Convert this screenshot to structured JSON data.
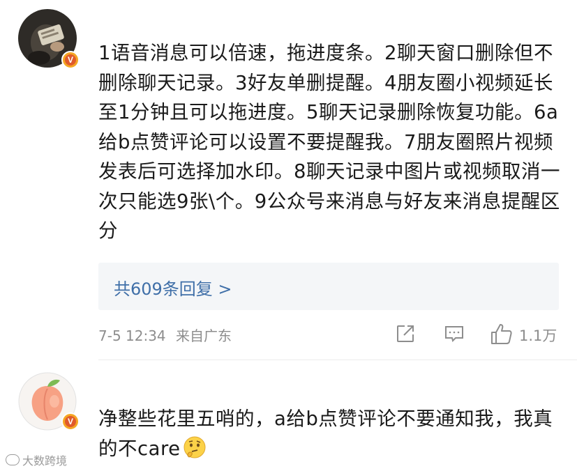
{
  "comments": [
    {
      "avatar": "photo-avatar",
      "badge": "V",
      "text": "1语音消息可以倍速，拖进度条。2聊天窗口删除但不删除聊天记录。3好友单删提醒。4朋友圈小视频延长至1分钟且可以拖进度。5聊天记录删除恢复功能。6a给b点赞评论可以设置不要提醒我。7朋友圈照片视频发表后可选择加水印。8聊天记录中图片或视频取消一次只能选9张\\个。9公众号来消息与好友来消息提醒区分",
      "replies_label": "共609条回复 >",
      "time": "7-5 12:34",
      "location": "来自广东",
      "likes": "1.1万"
    },
    {
      "avatar": "peach-avatar",
      "badge": "V",
      "text": "净整些花里五哨的，a给b点赞评论不要通知我，我真的不care",
      "emoji": "thinking-face-emoji"
    }
  ],
  "watermark": "大数跨境",
  "icons": {
    "share": "share-icon",
    "comment": "comment-icon",
    "like": "thumbs-up-icon"
  },
  "colors": {
    "link": "#3f6fa8",
    "meta": "#8d8d8d",
    "badge": "#f5a623",
    "replies_bg": "#f4f6f8"
  }
}
